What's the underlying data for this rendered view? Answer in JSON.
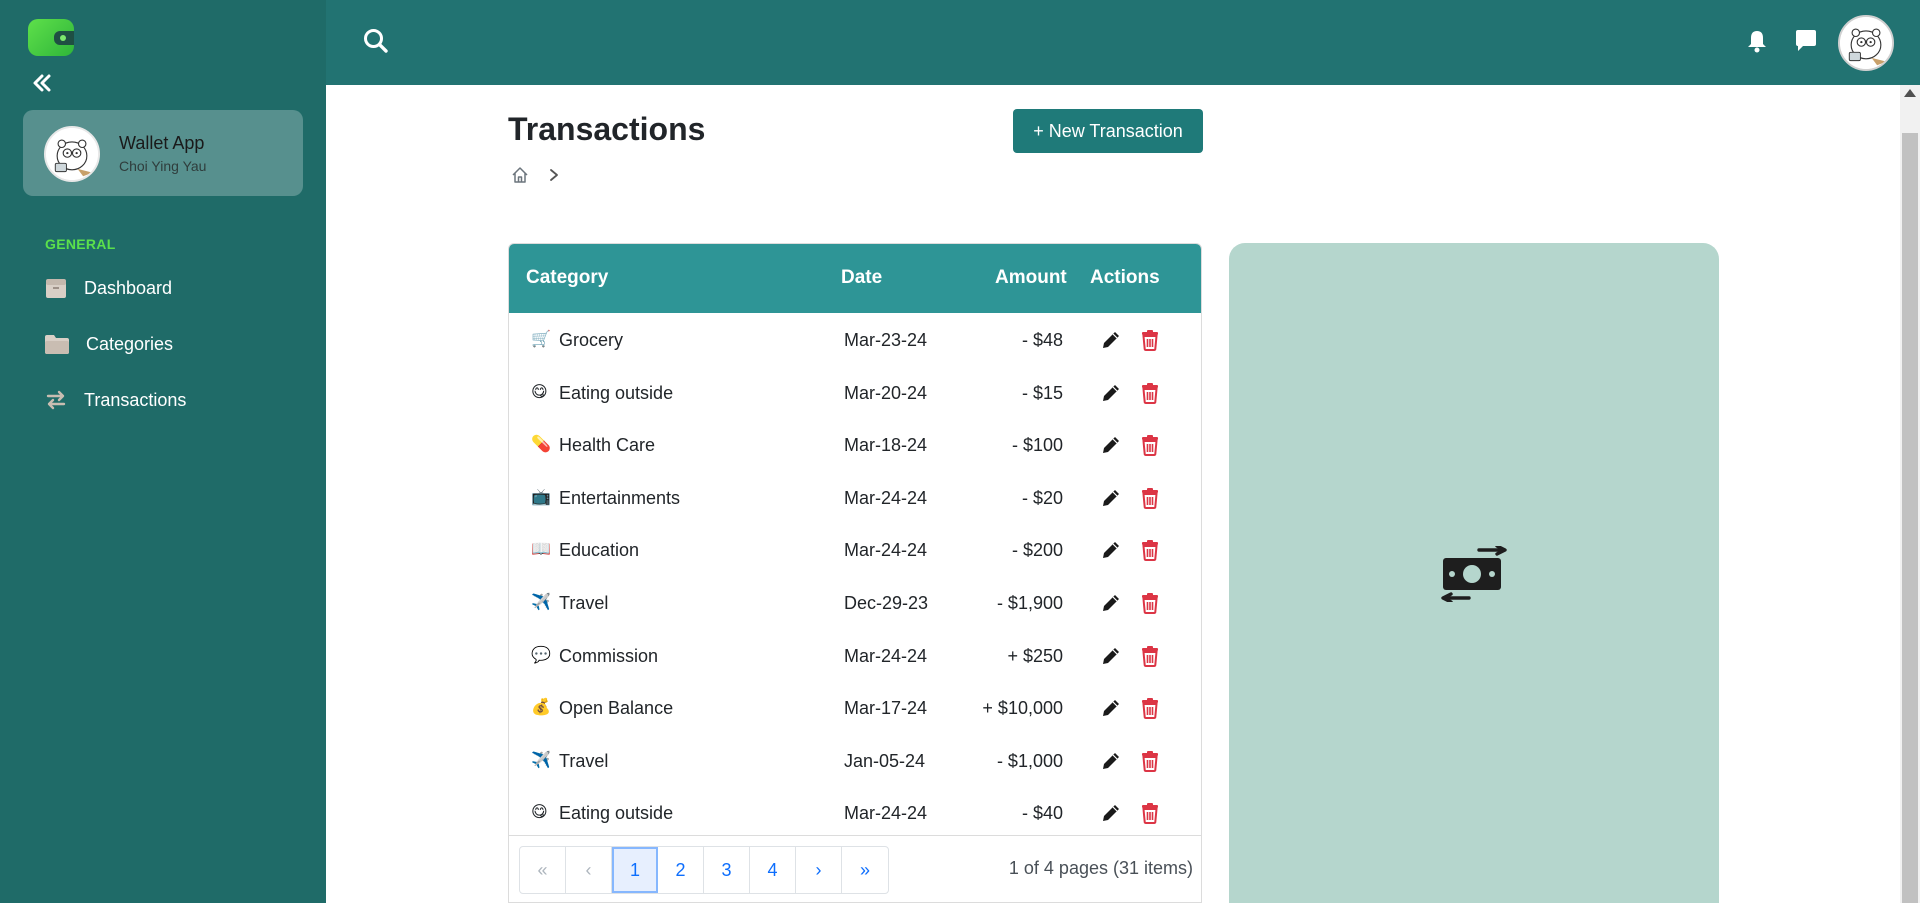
{
  "sidebar": {
    "profile": {
      "name": "Wallet App",
      "subtitle": "Choi Ying Yau"
    },
    "section_label": "GENERAL",
    "items": [
      {
        "label": "Dashboard",
        "icon": "box-icon"
      },
      {
        "label": "Categories",
        "icon": "folder-icon"
      },
      {
        "label": "Transactions",
        "icon": "arrows-exchange-icon"
      }
    ]
  },
  "header": {
    "icons": [
      "search-icon",
      "bell-icon",
      "chat-icon",
      "avatar"
    ]
  },
  "main": {
    "title": "Transactions",
    "new_button_label": "+ New Transaction",
    "table": {
      "columns": [
        "Category",
        "Date",
        "Amount",
        "Actions"
      ],
      "rows": [
        {
          "emoji": "🛒",
          "category": "Grocery",
          "date": "Mar-23-24",
          "amount": "- $48"
        },
        {
          "emoji": "😋",
          "category": "Eating outside",
          "date": "Mar-20-24",
          "amount": "- $15"
        },
        {
          "emoji": "💊",
          "category": "Health Care",
          "date": "Mar-18-24",
          "amount": "- $100"
        },
        {
          "emoji": "📺",
          "category": "Entertainments",
          "date": "Mar-24-24",
          "amount": "- $20"
        },
        {
          "emoji": "📖",
          "category": "Education",
          "date": "Mar-24-24",
          "amount": "- $200"
        },
        {
          "emoji": "✈️",
          "category": "Travel",
          "date": "Dec-29-23",
          "amount": "- $1,900"
        },
        {
          "emoji": "💬",
          "category": "Commission",
          "date": "Mar-24-24",
          "amount": "+ $250"
        },
        {
          "emoji": "💰",
          "category": "Open Balance",
          "date": "Mar-17-24",
          "amount": "+ $10,000"
        },
        {
          "emoji": "✈️",
          "category": "Travel",
          "date": "Jan-05-24",
          "amount": "- $1,000"
        },
        {
          "emoji": "😋",
          "category": "Eating outside",
          "date": "Mar-24-24",
          "amount": "- $40"
        }
      ]
    },
    "pagination": {
      "first": "«",
      "prev": "‹",
      "pages": [
        "1",
        "2",
        "3",
        "4"
      ],
      "active_page": "1",
      "next": "›",
      "last": "»",
      "info": "1 of 4 pages (31 items)"
    }
  },
  "colors": {
    "sidebar_bg": "#1f6b68",
    "topbar_bg": "#227372",
    "table_header_bg": "#2e9596",
    "primary_button": "#1f7a79",
    "accent_green": "#5be04b",
    "delete_red": "#dc3545",
    "illustration_bg": "#b5d6cd"
  }
}
